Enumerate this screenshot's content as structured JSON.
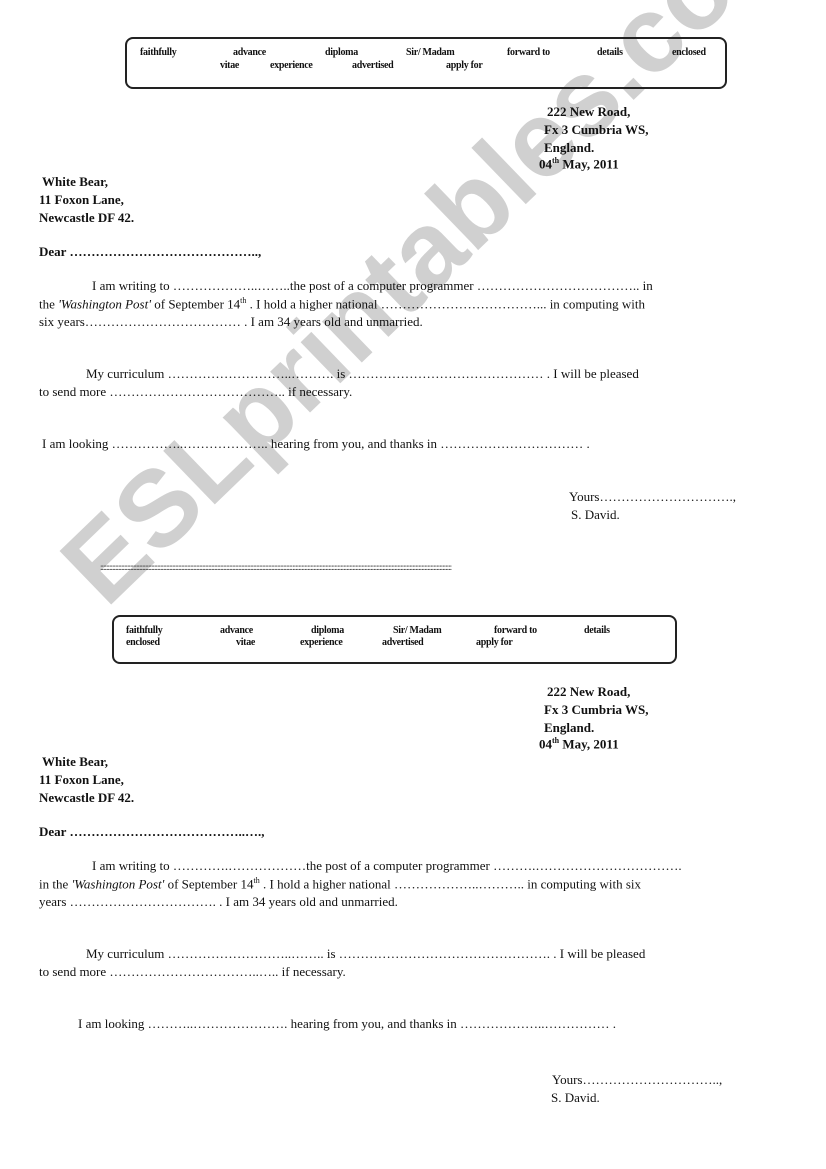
{
  "watermark": "ESLprintables.com",
  "word_box": [
    "faithfully",
    "advance",
    "diploma",
    "Sir/ Madam",
    "forward to",
    "details",
    "enclosed",
    "vitae",
    "experience",
    "advertised",
    "apply for"
  ],
  "sender_address": [
    "222  New Road,",
    "Fx 3 Cumbria WS,",
    "England."
  ],
  "date": {
    "day": "04",
    "suffix": "th",
    "rest": " May, 2011"
  },
  "recipient_address": [
    "White Bear,",
    "11 Foxon Lane,",
    "Newcastle DF 42."
  ],
  "letters": [
    {
      "greeting": "Dear ……………………………………..,",
      "p1": [
        "I am writing to ………………..……..the post of a computer programmer ……………………………….. in",
        "the |'Washington Post'| of September 14|th| . I hold a higher national ………………………………... in computing with",
        "six years……………………………… . I am 34 years old and unmarried."
      ],
      "p2": [
        "My curriculum ………………………..………. is ……………………………………… .  I will be pleased",
        "to send more    ………………………………….. if necessary."
      ],
      "p3": "I am looking ……………..……………….. hearing from you, and thanks in …………………………… .",
      "closing": "Yours………………………….,",
      "signature": "S. David."
    },
    {
      "greeting": "Dear …………………………………..….,",
      "p1": [
        "I am writing to ………….………………the post of a computer programmer ……….…………………………….",
        "in the |'Washington Post'| of September 14|th| . I hold a higher national ………………..……….. in computing with six",
        "years    ……………………………. . I am 34 years old and unmarried."
      ],
      "p2": [
        "My curriculum ………………………..…….. is …………………………………………. .  I will be pleased",
        "to send more    ……………………………..….. if necessary."
      ],
      "p3": "I am looking ………..…………………. hearing from you, and thanks in ………………..…………… .",
      "closing": "Yours…………………………..,",
      "signature": "S. David."
    }
  ],
  "separator": "::::::::::::::::::::::::::::::::::::::::::::::::::::::::::::::::::::::::::::::::::::::::::::::::::::::::::::::::::::::::::::::::::::::::::::::::::::::::::::::::::::::::::::::::::::::::::::::::::::::::::::::::::::::::::::::::::::::::::"
}
